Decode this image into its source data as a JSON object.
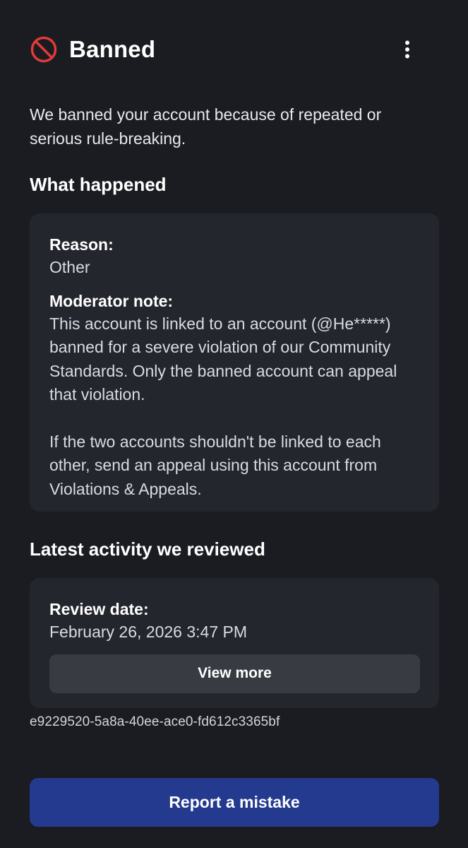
{
  "header": {
    "title": "Banned",
    "status_icon": "ban-icon",
    "menu_icon": "more-vertical-icon"
  },
  "intro": "We banned your account because of repeated or serious rule-breaking.",
  "what_happened": {
    "heading": "What happened",
    "reason_label": "Reason:",
    "reason_value": "Other",
    "note_label": "Moderator note:",
    "note_paragraph_1": "This account is linked to an account (@He*****) banned for a severe violation of our Community Standards. Only the banned account can appeal that violation.",
    "note_paragraph_2": "If the two accounts shouldn't be linked to each other, send an appeal using this account from Violations & Appeals."
  },
  "latest_activity": {
    "heading": "Latest activity we reviewed",
    "review_date_label": "Review date:",
    "review_date_value": "February 26, 2026 3:47 PM",
    "view_more_label": "View more"
  },
  "reference_id": "e9229520-5a8a-40ee-ace0-fd612c3365bf",
  "report_button_label": "Report a mistake",
  "colors": {
    "background": "#1a1c21",
    "card": "#24262d",
    "ban_red": "#e03a3a",
    "primary_button": "#243a8f",
    "secondary_button": "#393b43"
  }
}
